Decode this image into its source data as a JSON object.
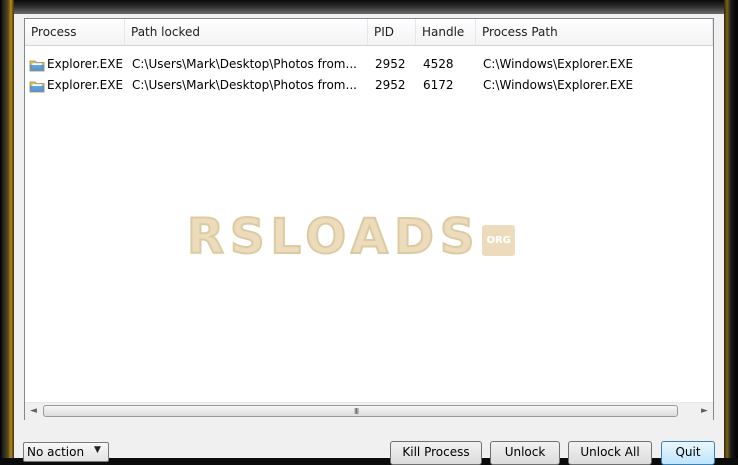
{
  "columns": [
    "Process",
    "Path locked",
    "PID",
    "Handle",
    "Process Path"
  ],
  "rows": [
    {
      "icon": "folder-icon",
      "process": "Explorer.EXE",
      "path_locked": "C:\\Users\\Mark\\Desktop\\Photos from...",
      "pid": "2952",
      "handle": "4528",
      "process_path": "C:\\Windows\\Explorer.EXE"
    },
    {
      "icon": "folder-icon",
      "process": "Explorer.EXE",
      "path_locked": "C:\\Users\\Mark\\Desktop\\Photos from...",
      "pid": "2952",
      "handle": "6172",
      "process_path": "C:\\Windows\\Explorer.EXE"
    }
  ],
  "scrollbar": {
    "left_arrow": "◄",
    "right_arrow": "►",
    "grip": "III"
  },
  "watermark": {
    "text": "RSLOADS",
    "suffix": "ORG"
  },
  "action_combo": {
    "selected": "No action",
    "arrow": "▼"
  },
  "buttons": {
    "kill_process": "Kill Process",
    "unlock": "Unlock",
    "unlock_all": "Unlock All",
    "quit": "Quit"
  },
  "colors": {
    "header_bg": "#f3f3f3",
    "list_bg": "#ffffff",
    "frame": "#0b0b0b",
    "accent_border": "#3c7fb1",
    "watermark": "#ead9b4"
  }
}
